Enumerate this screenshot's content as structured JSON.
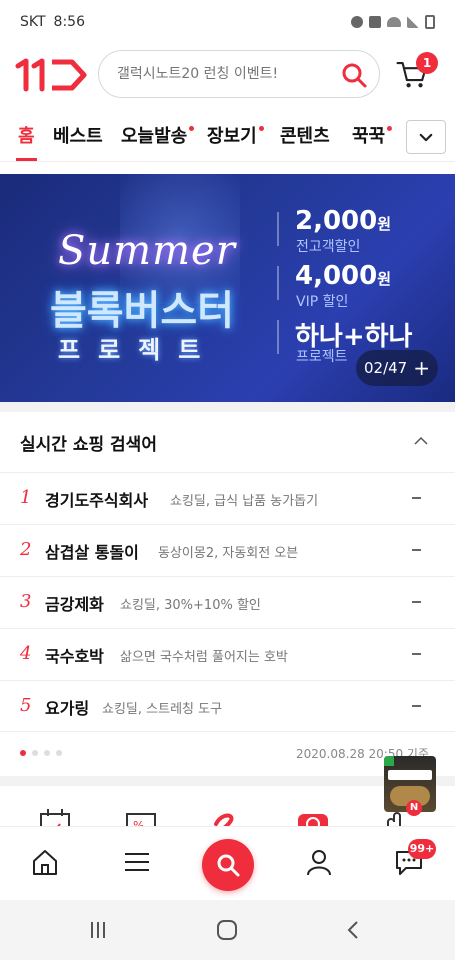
{
  "status_bar": {
    "carrier": "SKT",
    "time": "8:56"
  },
  "header": {
    "search_placeholder": "갤럭시노트20 런칭 이벤트!",
    "cart_count": "1"
  },
  "tabs": [
    {
      "label": "홈",
      "active": true,
      "dot": false
    },
    {
      "label": "베스트",
      "active": false,
      "dot": false
    },
    {
      "label": "오늘발송",
      "active": false,
      "dot": true
    },
    {
      "label": "장보기",
      "active": false,
      "dot": true
    },
    {
      "label": "콘텐츠",
      "active": false,
      "dot": false
    },
    {
      "label": "꾹꾹",
      "active": false,
      "dot": true
    }
  ],
  "banner": {
    "script": "Summer",
    "headline": "블록버스터",
    "subline": "프로젝트",
    "offers": [
      {
        "big": "2,000",
        "unit": "원",
        "small": "전고객할인"
      },
      {
        "big": "4,000",
        "unit": "원",
        "small": "VIP 할인"
      },
      {
        "big": "하나+하나",
        "unit": "",
        "small": "프로젝트"
      }
    ],
    "counter": "02/47",
    "counter_plus": "+"
  },
  "realtime": {
    "title": "실시간 쇼핑 검색어",
    "items": [
      {
        "rank": "1",
        "keyword": "경기도주식회사",
        "desc": "쇼킹딜, 급식 납품 농가돕기"
      },
      {
        "rank": "2",
        "keyword": "삼겹살 통돌이",
        "desc": "동상이몽2, 자동회전 오븐"
      },
      {
        "rank": "3",
        "keyword": "금강제화",
        "desc": "쇼킹딜, 30%+10% 할인"
      },
      {
        "rank": "4",
        "keyword": "국수호박",
        "desc": "삶으면 국수처럼 풀어지는 호박"
      },
      {
        "rank": "5",
        "keyword": "요가링",
        "desc": "쇼킹딜, 스트레칭 도구"
      }
    ],
    "timestamp": "2020.08.28 20:50 기준",
    "page_index": 0,
    "page_count": 4
  },
  "bottom_nav": {
    "chat_badge": "99+"
  },
  "colors": {
    "brand": "#ef2d3d",
    "banner_bg": "#243a9a"
  }
}
